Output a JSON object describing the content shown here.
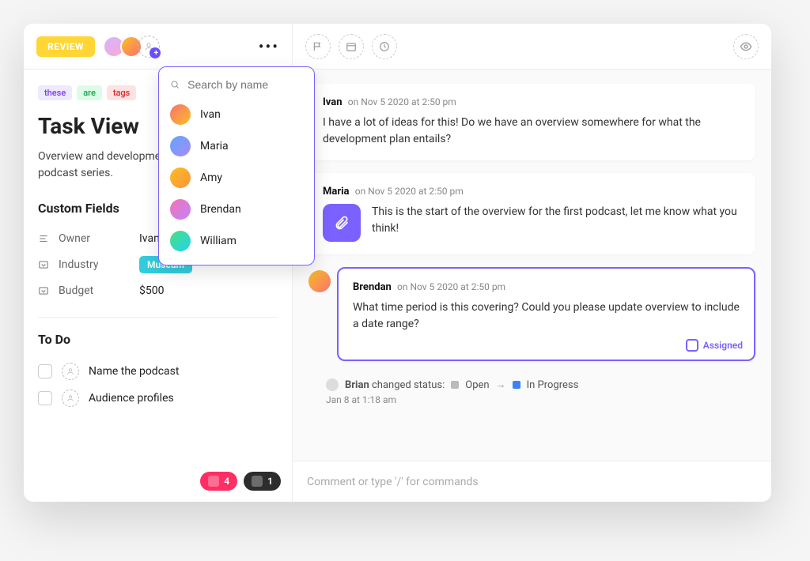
{
  "header": {
    "status_label": "REVIEW"
  },
  "dropdown": {
    "search_placeholder": "Search by name",
    "people": [
      {
        "name": "Ivan"
      },
      {
        "name": "Maria"
      },
      {
        "name": "Amy"
      },
      {
        "name": "Brendan"
      },
      {
        "name": "William"
      }
    ]
  },
  "tags": [
    "these",
    "are",
    "tags"
  ],
  "task": {
    "title": "Task View",
    "description": "Overview and development plan of original podcast series."
  },
  "custom_fields": {
    "heading": "Custom Fields",
    "rows": [
      {
        "label": "Owner",
        "value": "Ivan"
      },
      {
        "label": "Industry",
        "value": "Museum"
      },
      {
        "label": "Budget",
        "value": "$500"
      }
    ]
  },
  "todo": {
    "heading": "To Do",
    "items": [
      "Name the podcast",
      "Audience profiles"
    ]
  },
  "integrations": [
    {
      "count": "4"
    },
    {
      "count": "1"
    }
  ],
  "comments": [
    {
      "author": "Ivan",
      "meta": "on Nov 5 2020 at 2:50 pm",
      "body": "I have a lot of ideas for this! Do we have an overview somewhere for what the development plan entails?"
    },
    {
      "author": "Maria",
      "meta": "on Nov 5 2020 at 2:50 pm",
      "body": "This is the start of the overview for the first podcast, let me know what you think!"
    },
    {
      "author": "Brendan",
      "meta": "on Nov 5 2020 at 2:50 pm",
      "body": "What time period is this covering? Could you please update overview to include a date range?",
      "assigned_label": "Assigned"
    }
  ],
  "activity": {
    "actor": "Brian",
    "verb": "changed status:",
    "from": "Open",
    "to": "In Progress",
    "time": "Jan 8 at 1:18 am"
  },
  "composer": {
    "placeholder": "Comment or type '/' for commands"
  }
}
